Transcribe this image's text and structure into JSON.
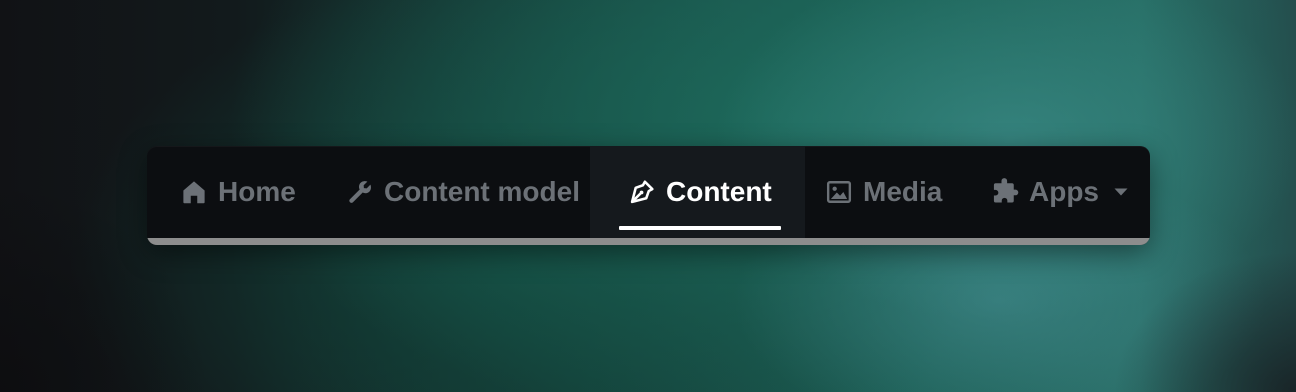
{
  "nav": {
    "items": [
      {
        "label": "Home",
        "icon": "home-icon",
        "active": false
      },
      {
        "label": "Content model",
        "icon": "wrench-icon",
        "active": false
      },
      {
        "label": "Content",
        "icon": "pen-nib-icon",
        "active": true
      },
      {
        "label": "Media",
        "icon": "image-icon",
        "active": false
      },
      {
        "label": "Apps",
        "icon": "puzzle-icon",
        "active": false,
        "has_dropdown": true
      }
    ]
  },
  "colors": {
    "navbar_bg": "#0c0e11",
    "active_bg": "#15191d",
    "inactive_text": "#6c7177",
    "active_text": "#ffffff",
    "bottom_bar": "#8d8d8d"
  }
}
